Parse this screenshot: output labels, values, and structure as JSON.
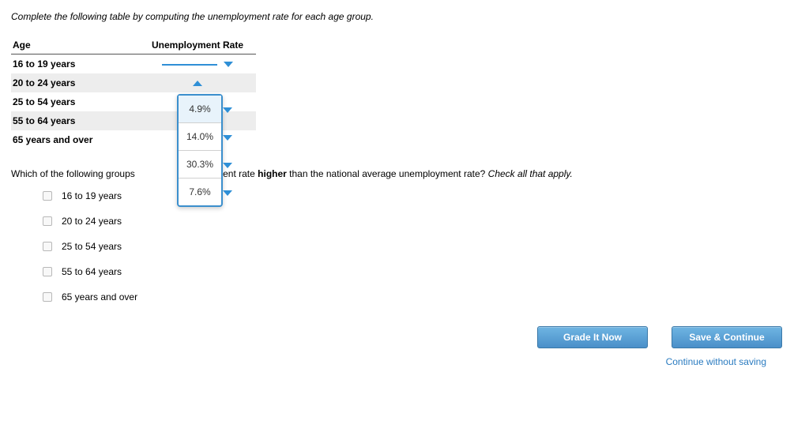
{
  "instruction": "Complete the following table by computing the unemployment rate for each age group.",
  "table": {
    "headers": {
      "age": "Age",
      "rate": "Unemployment Rate"
    },
    "rows": [
      {
        "age": "16 to 19 years"
      },
      {
        "age": "20 to 24 years"
      },
      {
        "age": "25 to 54 years"
      },
      {
        "age": "55 to 64 years"
      },
      {
        "age": "65 years and over"
      }
    ]
  },
  "dropdown_options": [
    "4.9%",
    "14.0%",
    "30.3%",
    "7.6%"
  ],
  "question2": {
    "prefix": "Which of the following groups",
    "partial_visible": "employment rate",
    "bold_word": "higher",
    "after": " than the national average unemployment rate? ",
    "ital": "Check all that apply."
  },
  "checkboxes": [
    "16 to 19 years",
    "20 to 24 years",
    "25 to 54 years",
    "55 to 64 years",
    "65 years and over"
  ],
  "buttons": {
    "grade": "Grade It Now",
    "save": "Save & Continue"
  },
  "link": "Continue without saving"
}
